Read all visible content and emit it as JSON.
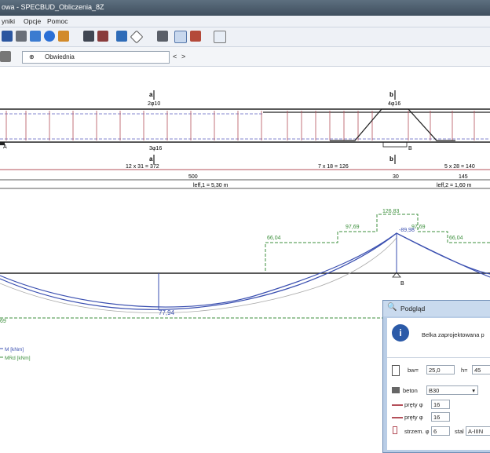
{
  "window": {
    "title": "owa - SPECBUD_Obliczenia_8Z"
  },
  "menu": {
    "items": [
      "yniki",
      "Opcje",
      "Pomoc"
    ]
  },
  "toolbar2": {
    "combo_value": "Obwiednia",
    "nav_prev": "<",
    "nav_next": ">"
  },
  "beam": {
    "label_a_top": "a",
    "label_b_top": "b",
    "rebar_top_a": "2φ10",
    "rebar_top_b": "4φ16",
    "label_a_mid": "a",
    "label_b_mid": "b",
    "rebar_bot_a": "3φ16",
    "support_a": "A",
    "support_b": "B",
    "spacing1": "12 x 31 = 372",
    "spacing2": "7 x 18 = 126",
    "spacing3": "5 x 28 = 140",
    "dim1": "500",
    "dim2": "30",
    "dim3": "145",
    "leff1": "leff,1 = 5,30 m",
    "leff2": "leff,2 = 1,60 m"
  },
  "diagram": {
    "v1": "126,83",
    "v2": "97,69",
    "v3": "97,69",
    "v4": "-89,98",
    "v5": "66,04",
    "v6": "66,04",
    "v7": "77,94",
    "v8": "69",
    "legend_m": "M [kNm]",
    "legend_mr": "MRd [kNm]",
    "support_b_label": "B"
  },
  "dialog": {
    "title": "Podgląd",
    "message": "Belka zaprojektowana p",
    "bw_label": "bw=",
    "bw_value": "25,0",
    "h_label": "h=",
    "h_value": "45",
    "beton_label": "beton",
    "beton_value": "B30",
    "prety1_label": "pręty φ",
    "prety1_value": "16",
    "prety2_label": "pręty φ",
    "prety2_value": "16",
    "strzem_label": "strzem. φ",
    "strzem_value": "6",
    "stal_label": "stal",
    "stal_value": "A-IIIN"
  },
  "colors": {
    "accent": "#2b5aa8",
    "beam_red": "#b4505a",
    "diagram_blue": "#3a4fb0",
    "diagram_green": "#3c8f3c"
  }
}
